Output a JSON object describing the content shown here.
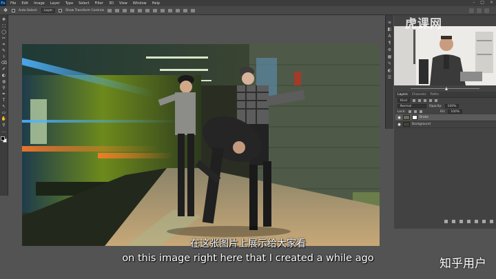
{
  "menubar": {
    "logo": "Ps",
    "items": [
      "File",
      "Edit",
      "Image",
      "Layer",
      "Type",
      "Select",
      "Filter",
      "3D",
      "View",
      "Window",
      "Help"
    ],
    "window_controls": [
      "–",
      "□",
      "×"
    ]
  },
  "options": {
    "tool_icon": "move-icon",
    "auto_select_label": "Auto-Select:",
    "auto_select_value": "Layer",
    "show_transform_label": "Show Transform Controls"
  },
  "tools": [
    "✥",
    "⬚",
    "◯",
    "✂",
    "⌗",
    "✎",
    "⚕",
    "⌫",
    "✐",
    "◐",
    "◍",
    "⚲",
    "✒",
    "T",
    "↖",
    "▭",
    "✋",
    "⚲",
    "…"
  ],
  "minipanel": [
    "≡",
    "◧",
    "A",
    "¶",
    "⚙",
    "▦",
    "✎",
    "◐",
    "☰"
  ],
  "watermark": "虎课网",
  "layers_panel": {
    "tabs": [
      "Layers",
      "Channels",
      "Paths"
    ],
    "active_tab": "Layers",
    "filter_label": "Kind",
    "blend_mode": "Normal",
    "opacity_label": "Opacity:",
    "opacity_value": "100%",
    "lock_label": "Lock:",
    "fill_label": "Fill:",
    "fill_value": "100%",
    "layers": [
      {
        "name": "Brake",
        "selected": true,
        "visible": true
      },
      {
        "name": "Background",
        "selected": false,
        "visible": true
      }
    ]
  },
  "subtitles": {
    "chinese": "在这张图片上展示给大家看",
    "english": "on this image right here that I created a while ago"
  },
  "brand": "知乎用户",
  "colors": {
    "app_bg": "#535353",
    "panel_bg": "#434343",
    "selected_layer": "#5b5b5b"
  }
}
